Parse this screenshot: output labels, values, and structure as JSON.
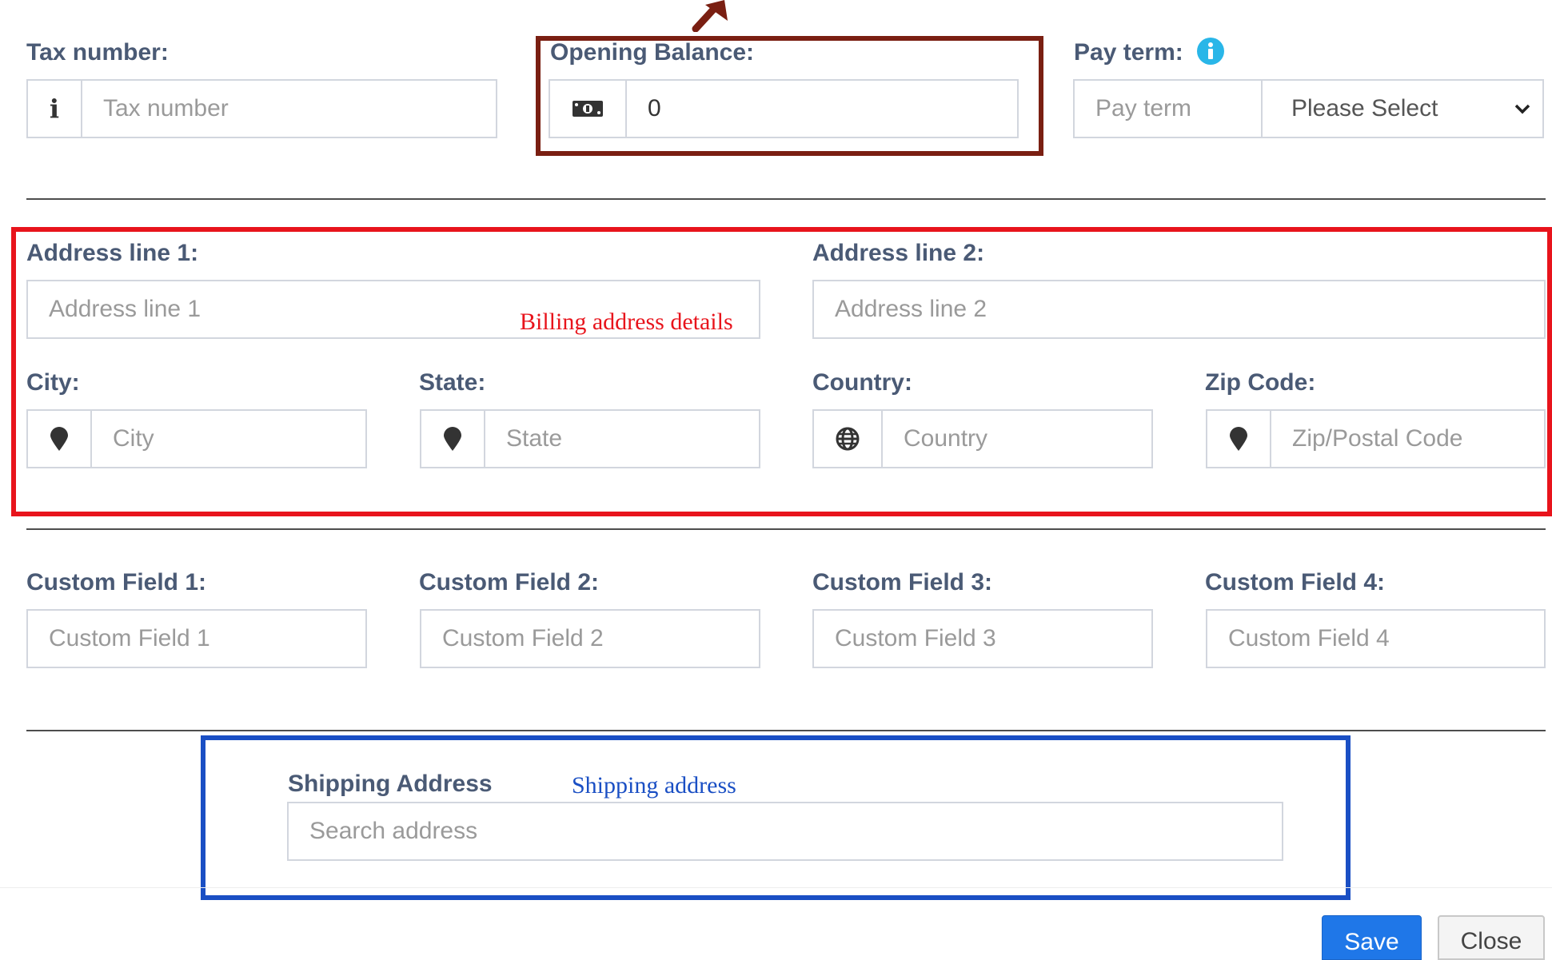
{
  "tax": {
    "label": "Tax number:",
    "placeholder": "Tax number"
  },
  "opening_balance": {
    "label": "Opening Balance:",
    "value": "0"
  },
  "pay_term": {
    "label": "Pay term:",
    "placeholder": "Pay term",
    "select_value": "Please Select"
  },
  "billing": {
    "address_line_1": {
      "label": "Address line 1:",
      "placeholder": "Address line 1"
    },
    "address_line_2": {
      "label": "Address line 2:",
      "placeholder": "Address line 2"
    },
    "city": {
      "label": "City:",
      "placeholder": "City"
    },
    "state": {
      "label": "State:",
      "placeholder": "State"
    },
    "country": {
      "label": "Country:",
      "placeholder": "Country"
    },
    "zip": {
      "label": "Zip Code:",
      "placeholder": "Zip/Postal Code"
    },
    "annotation": "Billing address details"
  },
  "custom_fields": [
    {
      "label": "Custom Field 1:",
      "placeholder": "Custom Field 1"
    },
    {
      "label": "Custom Field 2:",
      "placeholder": "Custom Field 2"
    },
    {
      "label": "Custom Field 3:",
      "placeholder": "Custom Field 3"
    },
    {
      "label": "Custom Field 4:",
      "placeholder": "Custom Field 4"
    }
  ],
  "shipping": {
    "label": "Shipping Address",
    "placeholder": "Search address",
    "annotation": "Shipping address"
  },
  "buttons": {
    "save": "Save",
    "close": "Close"
  },
  "colors": {
    "label": "#4a5a75",
    "annotation_dark_red": "#7a1f12",
    "annotation_red": "#e8141c",
    "annotation_blue": "#1a4fc4",
    "info_icon": "#29b6e8",
    "save_button": "#1f77e8"
  },
  "icons": {
    "tax_addon": "info-icon",
    "opening_balance_addon": "money-icon",
    "pay_term_info": "info-circle-icon",
    "city_addon": "map-marker-icon",
    "state_addon": "map-marker-icon",
    "country_addon": "globe-icon",
    "zip_addon": "map-marker-icon",
    "annotation_pointer": "arrow-icon"
  }
}
